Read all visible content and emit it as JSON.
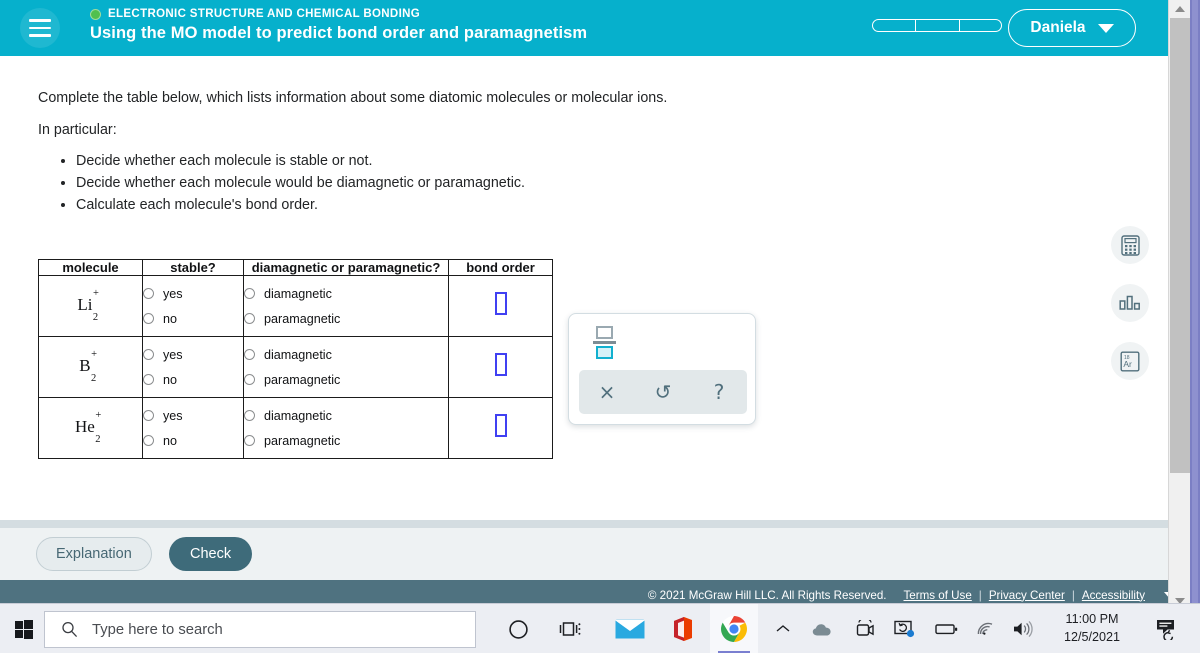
{
  "header": {
    "eyebrow": "ELECTRONIC STRUCTURE AND CHEMICAL BONDING",
    "title": "Using the MO model to predict bond order and paramagnetism",
    "user_name": "Daniela",
    "menu_icon": "hamburger-icon",
    "status_dot_color": "#51c04e",
    "background_color": "#06b0cc",
    "progress_segments": 3
  },
  "content": {
    "intro_line_1": "Complete the table below, which lists information about some diatomic molecules or molecular ions.",
    "intro_line_2": "In particular:",
    "bullets": [
      "Decide whether each molecule is stable or not.",
      "Decide whether each molecule would be diamagnetic or paramagnetic.",
      "Calculate each molecule's bond order."
    ]
  },
  "table": {
    "headers": {
      "molecule": "molecule",
      "stable": "stable?",
      "magnetic": "diamagnetic or paramagnetic?",
      "bond_order": "bond order"
    },
    "stable_options": [
      "yes",
      "no"
    ],
    "magnetic_options": [
      "diamagnetic",
      "paramagnetic"
    ],
    "rows": [
      {
        "element": "Li",
        "charge": "+",
        "count": "2",
        "stable_selected": "",
        "magnetic_selected": "",
        "bond_order_value": ""
      },
      {
        "element": "B",
        "charge": "+",
        "count": "2",
        "stable_selected": "",
        "magnetic_selected": "",
        "bond_order_value": ""
      },
      {
        "element": "He",
        "charge": "+",
        "count": "2",
        "stable_selected": "",
        "magnetic_selected": "",
        "bond_order_value": ""
      }
    ]
  },
  "keypad": {
    "fraction_icon": "fraction-template-icon",
    "buttons": [
      {
        "name": "clear-button",
        "glyph": "×"
      },
      {
        "name": "undo-button",
        "glyph": "↺"
      },
      {
        "name": "help-button",
        "glyph": "?"
      }
    ]
  },
  "rail": {
    "items": [
      {
        "name": "calculator-icon",
        "label": "Calculator"
      },
      {
        "name": "bar-chart-icon",
        "label": "Chart"
      },
      {
        "name": "periodic-table-icon",
        "label": "Ar"
      }
    ],
    "periodic_symbol": "Ar",
    "periodic_number": "18"
  },
  "actions": {
    "explanation_label": "Explanation",
    "check_label": "Check"
  },
  "footer": {
    "copyright": "© 2021 McGraw Hill LLC. All Rights Reserved.",
    "links": [
      "Terms of Use",
      "Privacy Center",
      "Accessibility"
    ],
    "separator": "|"
  },
  "taskbar": {
    "search_placeholder": "Type here to search",
    "time": "11:00 PM",
    "date": "12/5/2021",
    "apps": [
      {
        "name": "taskbar-mail-icon"
      },
      {
        "name": "taskbar-office-icon"
      },
      {
        "name": "taskbar-chrome-icon"
      }
    ]
  }
}
